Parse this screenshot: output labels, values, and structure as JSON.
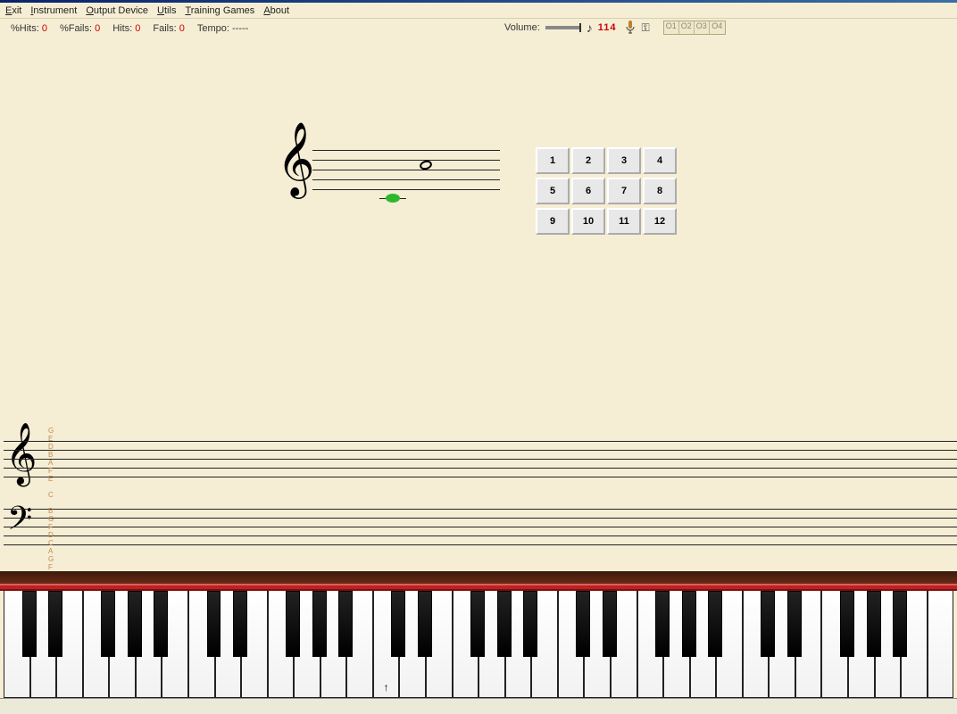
{
  "menu": {
    "exit": "Exit",
    "instrument": "Instrument",
    "output_device": "Output Device",
    "utils": "Utils",
    "training_games": "Training Games",
    "about": "About"
  },
  "stats": {
    "pchits_label": "%Hits:",
    "pchits_value": "0",
    "pcfails_label": "%Fails:",
    "pcfails_value": "0",
    "hits_label": "Hits:",
    "hits_value": "0",
    "fails_label": "Fails:",
    "fails_value": "0",
    "tempo_label": "Tempo:",
    "tempo_value": "-----"
  },
  "volume": {
    "label": "Volume:",
    "value": "114"
  },
  "octaves": {
    "o1": "O1",
    "o2": "O2",
    "o3": "O3",
    "o4": "O4"
  },
  "numpad": [
    "1",
    "2",
    "3",
    "4",
    "5",
    "6",
    "7",
    "8",
    "9",
    "10",
    "11",
    "12"
  ],
  "grand_staff_labels": [
    "G",
    "E",
    "D",
    "B",
    "A",
    "F",
    "E",
    "",
    "C",
    "",
    "B",
    "G",
    "F",
    "D",
    "C",
    "A",
    "G",
    "F"
  ],
  "piano": {
    "white_key_count": 36,
    "middle_c_marker": "↑",
    "middle_c_index": 14
  }
}
